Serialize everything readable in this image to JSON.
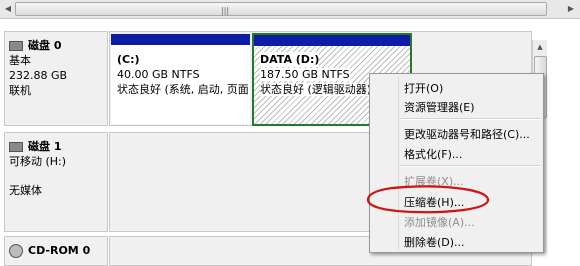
{
  "disks": [
    {
      "name": "磁盘 0",
      "type": "基本",
      "size": "232.88 GB",
      "status": "联机",
      "partitions": [
        {
          "title": "(C:)",
          "size_fs": "40.00 GB NTFS",
          "status": "状态良好 (系统, 启动, 页面"
        },
        {
          "title": "DATA  (D:)",
          "size_fs": "187.50 GB NTFS",
          "status": "状态良好 (逻辑驱动器)"
        }
      ]
    },
    {
      "name": "磁盘 1",
      "type": "可移动 (H:)",
      "media": "无媒体"
    },
    {
      "name": "CD-ROM 0"
    }
  ],
  "context_menu": {
    "items": [
      {
        "label": "打开(O)",
        "enabled": true
      },
      {
        "label": "资源管理器(E)",
        "enabled": true
      },
      {
        "label": "更改驱动器号和路径(C)...",
        "enabled": true
      },
      {
        "label": "格式化(F)...",
        "enabled": true
      },
      {
        "label": "扩展卷(X)...",
        "enabled": false
      },
      {
        "label": "压缩卷(H)...",
        "enabled": true
      },
      {
        "label": "添加镜像(A)...",
        "enabled": false
      },
      {
        "label": "删除卷(D)...",
        "enabled": true
      }
    ]
  },
  "colors": {
    "partition_bar": "#0f1ca8",
    "selection_border": "#257a2a",
    "annotation": "#d21414"
  }
}
